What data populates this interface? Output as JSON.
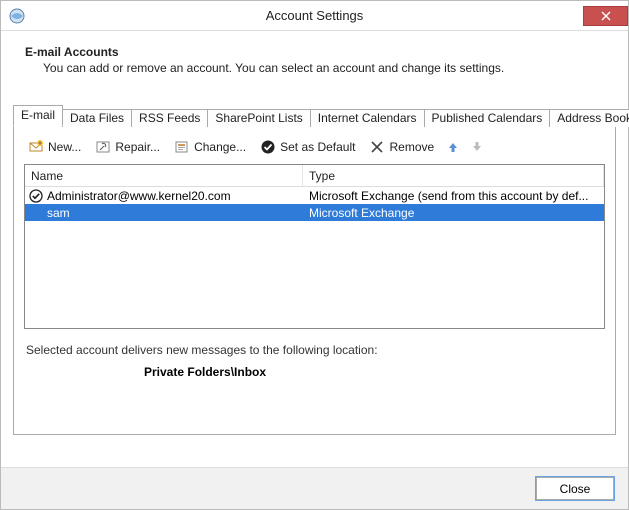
{
  "window": {
    "title": "Account Settings"
  },
  "header": {
    "title": "E-mail Accounts",
    "description": "You can add or remove an account. You can select an account and change its settings."
  },
  "tabs": [
    {
      "label": "E-mail",
      "active": true
    },
    {
      "label": "Data Files"
    },
    {
      "label": "RSS Feeds"
    },
    {
      "label": "SharePoint Lists"
    },
    {
      "label": "Internet Calendars"
    },
    {
      "label": "Published Calendars"
    },
    {
      "label": "Address Books"
    }
  ],
  "toolbar": {
    "new_label": "New...",
    "repair_label": "Repair...",
    "change_label": "Change...",
    "default_label": "Set as Default",
    "remove_label": "Remove"
  },
  "columns": {
    "name": "Name",
    "type": "Type"
  },
  "accounts": [
    {
      "name": "Administrator@www.kernel20.com",
      "type": "Microsoft Exchange (send from this account by def...",
      "is_default": true,
      "selected": false
    },
    {
      "name": "sam",
      "type": "Microsoft Exchange",
      "is_default": false,
      "selected": true
    }
  ],
  "delivery": {
    "text": "Selected account delivers new messages to the following location:",
    "location": "Private Folders\\Inbox"
  },
  "footer": {
    "close_label": "Close"
  }
}
